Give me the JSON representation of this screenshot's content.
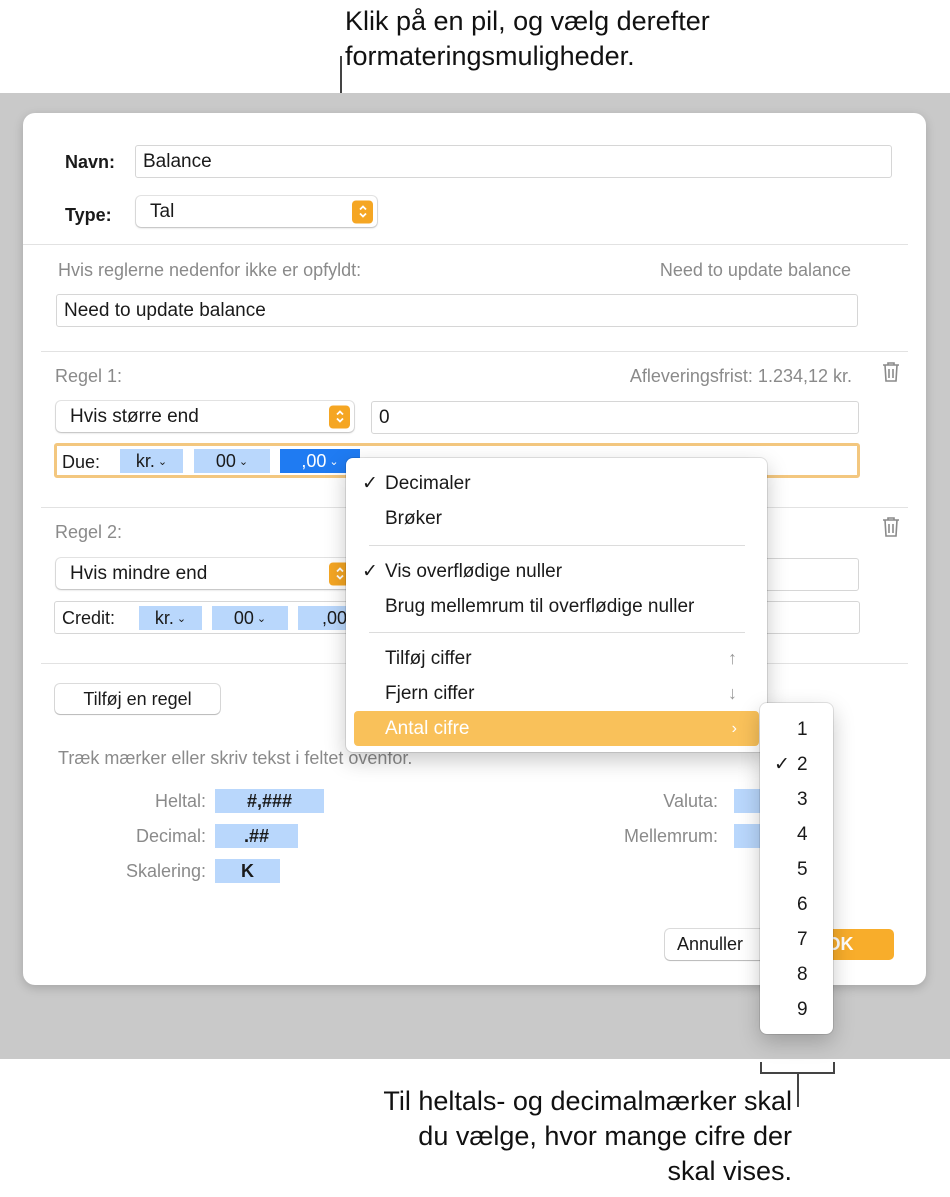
{
  "callouts": {
    "top": "Klik på en pil, og vælg derefter formateringsmuligheder.",
    "bottom": "Til heltals- og decimalmærker skal du vælge, hvor mange cifre der skal vises."
  },
  "form": {
    "name_label": "Navn:",
    "name_value": "Balance",
    "type_label": "Type:",
    "type_value": "Tal",
    "fallback_label": "Hvis reglerne nedenfor ikke er opfyldt:",
    "fallback_preview": "Need to update balance",
    "fallback_value": "Need to update balance"
  },
  "rule1": {
    "title": "Regel 1:",
    "preview": "Afleveringsfrist: 1.234,12 kr.",
    "condition": "Hvis større end",
    "value": "0",
    "format_label": "Due:",
    "tokens": [
      "kr.",
      "00",
      ",00"
    ]
  },
  "rule2": {
    "title": "Regel 2:",
    "condition": "Hvis mindre end",
    "format_label": "Credit:",
    "tokens": [
      "kr.",
      "00",
      ",00"
    ]
  },
  "add_rule_button": "Tilføj en regel",
  "hint": "Træk mærker eller skriv tekst i feltet ovenfor.",
  "palette": {
    "integer_label": "Heltal:",
    "integer_token": "#,###",
    "decimal_label": "Decimal:",
    "decimal_token": ".##",
    "scaling_label": "Skalering:",
    "scaling_token": "K",
    "currency_label": "Valuta:",
    "spacing_label": "Mellemrum:"
  },
  "buttons": {
    "cancel": "Annuller",
    "ok": "OK"
  },
  "menu": {
    "decimals": "Decimaler",
    "fractions": "Brøker",
    "show_trailing_zeros": "Vis overflødige nuller",
    "spaces_for_trailing_zeros": "Brug mellemrum til overflødige nuller",
    "add_digit": "Tilføj ciffer",
    "add_digit_key": "↑",
    "remove_digit": "Fjern ciffer",
    "remove_digit_key": "↓",
    "num_digits": "Antal cifre",
    "check": "✓",
    "submenu_arrow": "›"
  },
  "digits_submenu": {
    "options": [
      "1",
      "2",
      "3",
      "4",
      "5",
      "6",
      "7",
      "8",
      "9"
    ],
    "selected": "2"
  },
  "colors": {
    "accent": "#f5a623",
    "token": "#b9d7fc",
    "token_selected": "#1f7bf2",
    "menu_highlight": "#f9c15a"
  }
}
